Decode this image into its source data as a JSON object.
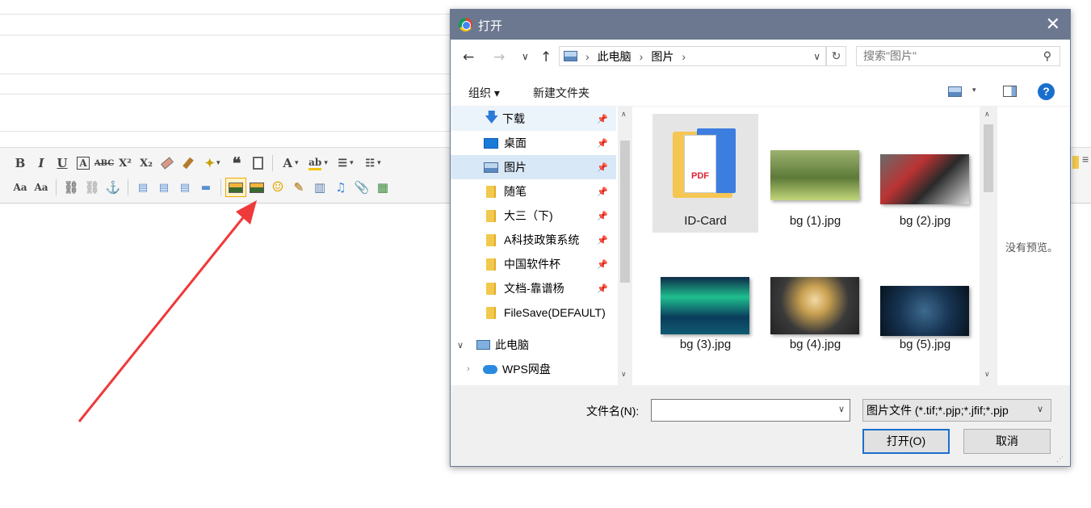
{
  "editor_toolbar": {
    "row1": [
      "B",
      "I",
      "U",
      "A",
      "ABC",
      "X²",
      "X₂",
      "eraser",
      "brush",
      "wand",
      "❝",
      "paste-text",
      "A",
      "ab",
      "ordered-list",
      "bullet-list"
    ],
    "row2": [
      "line-height-up",
      "line-height-down",
      "link",
      "unlink",
      "anchor",
      "align-left",
      "align-center",
      "align-right",
      "align-justify",
      "image",
      "multi-image",
      "emoji",
      "painter",
      "video",
      "music",
      "attachment",
      "map"
    ]
  },
  "dialog": {
    "title": "打开",
    "close_glyph": "✕",
    "nav": {
      "back": "←",
      "forward": "→",
      "recent": "∨",
      "up": "↑"
    },
    "address": {
      "crumbs": [
        "此电脑",
        "图片"
      ],
      "sep": "›"
    },
    "refresh_glyph": "↻",
    "search_placeholder": "搜索\"图片\"",
    "search_glyph": "⚲",
    "commands": {
      "organize": "组织 ▾",
      "new_folder": "新建文件夹",
      "help": "?"
    },
    "nav_pane": [
      {
        "label": "下载",
        "icon": "download-arrow-icon",
        "pinned": true
      },
      {
        "label": "桌面",
        "icon": "desktop-icon",
        "pinned": true
      },
      {
        "label": "图片",
        "icon": "pictures-icon",
        "pinned": true,
        "selected": true
      },
      {
        "label": "随笔",
        "icon": "folder-icon",
        "pinned": true
      },
      {
        "label": "大三（下)",
        "icon": "folder-icon",
        "pinned": true
      },
      {
        "label": "A科技政策系统",
        "icon": "folder-icon",
        "pinned": true
      },
      {
        "label": "中国软件杯",
        "icon": "folder-icon",
        "pinned": true
      },
      {
        "label": "文档-靠谱杨",
        "icon": "folder-icon",
        "pinned": true
      },
      {
        "label": "FileSave(DEFAULT)",
        "icon": "folder-icon",
        "pinned": false
      },
      {
        "label": "此电脑",
        "icon": "computer-icon",
        "expanded": true
      },
      {
        "label": "WPS网盘",
        "icon": "cloud-icon",
        "expanded": false
      }
    ],
    "files": [
      {
        "label": "ID-Card",
        "kind": "folder",
        "selected": true
      },
      {
        "label": "bg (1).jpg",
        "kind": "image",
        "colors": [
          "#8fa866",
          "#3c5a2a",
          "#c0392b"
        ]
      },
      {
        "label": "bg (2).jpg",
        "kind": "image",
        "colors": [
          "#5a5a5a",
          "#c0392b",
          "#e6e6e6"
        ]
      },
      {
        "label": "bg (3).jpg",
        "kind": "image",
        "colors": [
          "#0b2d4a",
          "#2ecc71",
          "#0d4f6e"
        ]
      },
      {
        "label": "bg (4).jpg",
        "kind": "image",
        "colors": [
          "#3b3b3b",
          "#f1c27d",
          "#d4a017"
        ]
      },
      {
        "label": "bg (5).jpg",
        "kind": "image",
        "colors": [
          "#0a1a2a",
          "#1b3a5a",
          "#4a7aa0"
        ]
      }
    ],
    "preview_text": "没有预览。",
    "filename_label": "文件名(N):",
    "filename_value": "",
    "filetype_value": "图片文件 (*.tif;*.pjp;*.jfif;*.pjp",
    "open_button": "打开(O)",
    "cancel_button": "取消"
  },
  "colors": {
    "titlebar": "#6b7890",
    "selection": "#d9e8f7",
    "accent": "#1a6fce",
    "arrow": "#ee3a3a"
  }
}
